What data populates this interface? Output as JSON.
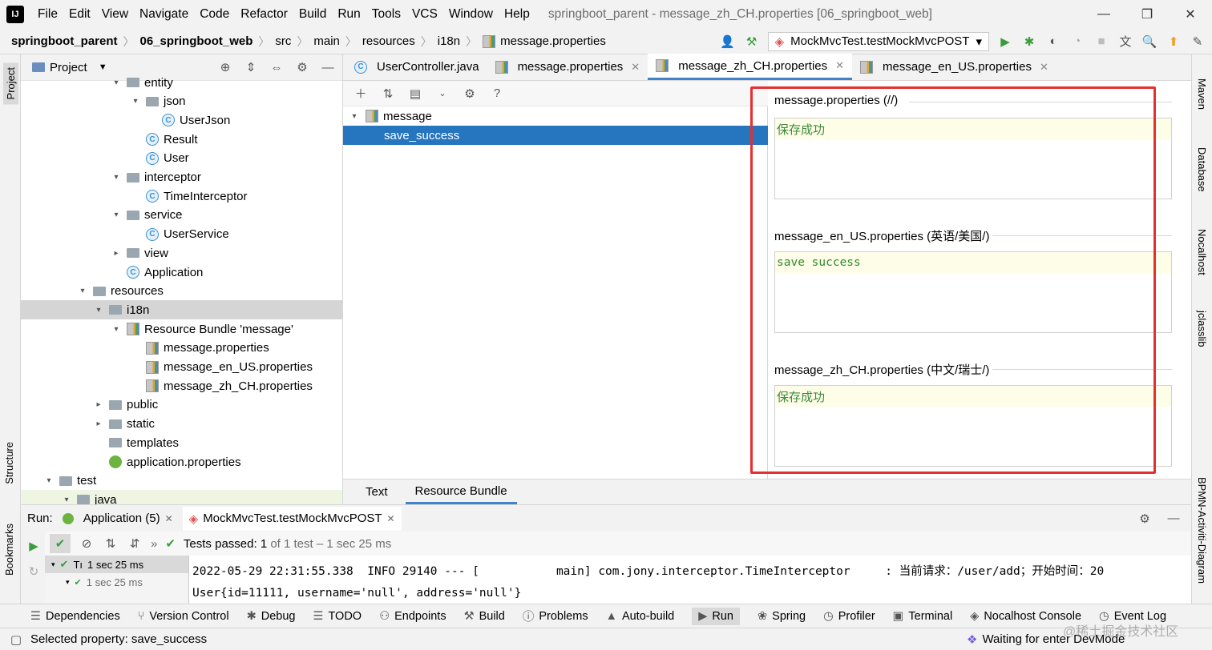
{
  "window": {
    "title": "springboot_parent - message_zh_CH.properties [06_springboot_web]",
    "menus": [
      "File",
      "Edit",
      "View",
      "Navigate",
      "Code",
      "Refactor",
      "Build",
      "Run",
      "Tools",
      "VCS",
      "Window",
      "Help"
    ]
  },
  "breadcrumb": [
    "springboot_parent",
    "06_springboot_web",
    "src",
    "main",
    "resources",
    "i18n",
    "message.properties"
  ],
  "run_config": "MockMvcTest.testMockMvcPOST",
  "project_panel": {
    "title": "Project",
    "tree": [
      {
        "label": "entity",
        "indent": 158,
        "arrow": "▾",
        "icon": "folder"
      },
      {
        "label": "json",
        "indent": 182,
        "arrow": "▾",
        "icon": "folder"
      },
      {
        "label": "UserJson",
        "indent": 202,
        "arrow": "",
        "icon": "class"
      },
      {
        "label": "Result",
        "indent": 182,
        "arrow": "",
        "icon": "class"
      },
      {
        "label": "User",
        "indent": 182,
        "arrow": "",
        "icon": "class"
      },
      {
        "label": "interceptor",
        "indent": 158,
        "arrow": "▾",
        "icon": "folder"
      },
      {
        "label": "TimeInterceptor",
        "indent": 182,
        "arrow": "",
        "icon": "class"
      },
      {
        "label": "service",
        "indent": 158,
        "arrow": "▾",
        "icon": "folder"
      },
      {
        "label": "UserService",
        "indent": 182,
        "arrow": "",
        "icon": "class"
      },
      {
        "label": "view",
        "indent": 158,
        "arrow": "▸",
        "icon": "folder"
      },
      {
        "label": "Application",
        "indent": 158,
        "arrow": "",
        "icon": "class"
      },
      {
        "label": "resources",
        "indent": 116,
        "arrow": "▾",
        "icon": "folder"
      },
      {
        "label": "i18n",
        "indent": 136,
        "arrow": "▾",
        "icon": "folder",
        "selected": true
      },
      {
        "label": "Resource Bundle 'message'",
        "indent": 158,
        "arrow": "▾",
        "icon": "bundle"
      },
      {
        "label": "message.properties",
        "indent": 182,
        "arrow": "",
        "icon": "props"
      },
      {
        "label": "message_en_US.properties",
        "indent": 182,
        "arrow": "",
        "icon": "props"
      },
      {
        "label": "message_zh_CH.properties",
        "indent": 182,
        "arrow": "",
        "icon": "props"
      },
      {
        "label": "public",
        "indent": 136,
        "arrow": "▸",
        "icon": "folder"
      },
      {
        "label": "static",
        "indent": 136,
        "arrow": "▸",
        "icon": "folder"
      },
      {
        "label": "templates",
        "indent": 136,
        "arrow": "",
        "icon": "folder"
      },
      {
        "label": "application.properties",
        "indent": 136,
        "arrow": "",
        "icon": "spring"
      },
      {
        "label": "test",
        "indent": 74,
        "arrow": "▾",
        "icon": "folder"
      },
      {
        "label": "java",
        "indent": 96,
        "arrow": "▾",
        "icon": "folder",
        "highlight": true
      }
    ]
  },
  "editor_tabs": [
    {
      "label": "UserController.java",
      "icon": "class",
      "active": false,
      "closable": false
    },
    {
      "label": "message.properties",
      "icon": "props",
      "active": false,
      "closable": true
    },
    {
      "label": "message_zh_CH.properties",
      "icon": "props",
      "active": true,
      "closable": true
    },
    {
      "label": "message_en_US.properties",
      "icon": "props",
      "active": false,
      "closable": true
    }
  ],
  "bundle_tree": {
    "root": "message",
    "selected_key": "save_success"
  },
  "bundle_props": [
    {
      "label": "message.properties (//)",
      "value": "保存成功",
      "mono": false
    },
    {
      "label": "message_en_US.properties (英语/美国/)",
      "value": "save success",
      "mono": true
    },
    {
      "label": "message_zh_CH.properties (中文/瑞士/)",
      "value": "保存成功",
      "mono": false
    }
  ],
  "editor_bottom_tabs": [
    "Text",
    "Resource Bundle"
  ],
  "run_panel": {
    "label": "Run:",
    "tabs": [
      "Application (5)",
      "MockMvcTest.testMockMvcPOST"
    ],
    "tests_passed_prefix": "Tests passed:",
    "tests_passed_count": "1",
    "tests_passed_suffix": "of 1 test – 1 sec 25 ms",
    "tree_row1": "1 sec 25 ms",
    "tree_row2": "1 sec 25 ms",
    "console_lines": [
      "2022-05-29 22:31:55.338  INFO 29140 --- [           main] com.jony.interceptor.TimeInterceptor     : 当前请求：/user/add；开始时间：20",
      "User{id=11111, username='null', address='null'}"
    ]
  },
  "tool_windows": [
    "Dependencies",
    "Version Control",
    "Debug",
    "TODO",
    "Endpoints",
    "Build",
    "Problems",
    "Auto-build",
    "Run",
    "Spring",
    "Profiler",
    "Terminal",
    "Nocalhost Console",
    "Event Log"
  ],
  "left_strip": [
    "Project",
    "Structure",
    "Bookmarks"
  ],
  "right_strip": [
    "Maven",
    "Database",
    "Nocalhost",
    "jclasslib",
    "BPMN-Activiti-Diagram"
  ],
  "status": {
    "left": "Selected property: save_success",
    "right": "Waiting for enter DevMode"
  },
  "watermark": "@稀土掘金技术社区",
  "colors": {
    "accent": "#4083c9",
    "selection": "#2675bf",
    "highlight_box": "#e53030",
    "value_green": "#3c8a3c"
  }
}
